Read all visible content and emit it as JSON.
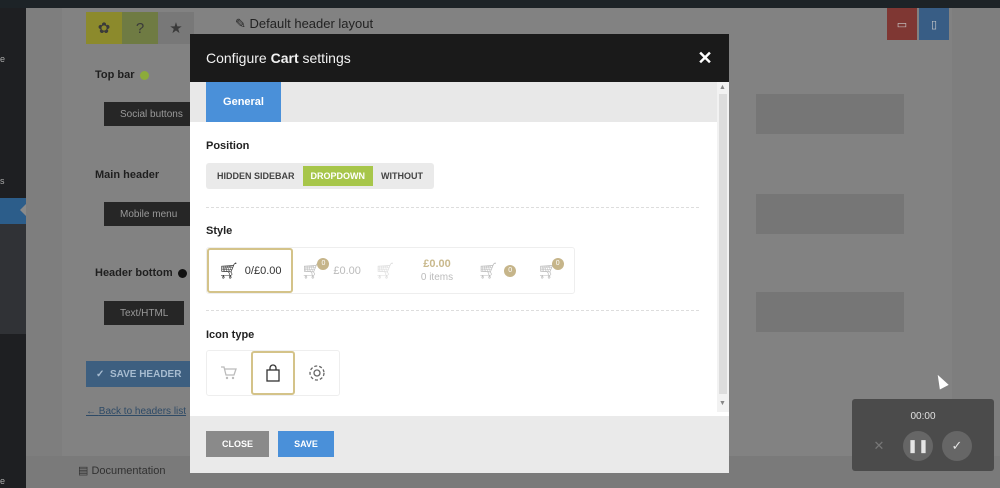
{
  "background": {
    "header_layout_title": "Default header layout",
    "sections": {
      "top_bar": {
        "label": "Top bar",
        "button": "Social buttons"
      },
      "main_header": {
        "label": "Main header",
        "button": "Mobile menu"
      },
      "header_bottom": {
        "label": "Header bottom",
        "button": "Text/HTML"
      }
    },
    "save_header_label": "SAVE HEADER",
    "back_link": "Back to headers list",
    "documentation_link": "Documentation",
    "sidebar_letters": [
      "e",
      "s",
      "e"
    ],
    "colors": {
      "top_bar_dot": "#8cab3a",
      "header_bottom_dot": "#111111"
    }
  },
  "modal": {
    "title_prefix": "Configure ",
    "title_bold": "Cart",
    "title_suffix": " settings",
    "close_symbol": "✕",
    "tabs": [
      {
        "label": "General",
        "active": true
      }
    ],
    "position": {
      "label": "Position",
      "options": [
        {
          "label": "HIDDEN SIDEBAR",
          "active": false
        },
        {
          "label": "DROPDOWN",
          "active": true
        },
        {
          "label": "WITHOUT",
          "active": false
        }
      ]
    },
    "style": {
      "label": "Style",
      "options": [
        {
          "count": "0",
          "sep": " / ",
          "price": "£0.00",
          "active": true
        },
        {
          "badge": "0",
          "price": "£0.00",
          "active": false
        },
        {
          "active": false
        },
        {
          "price": "£0.00",
          "items": "0 items",
          "active": false
        },
        {
          "badge": "0",
          "active": false
        },
        {
          "badge": "0",
          "active": false
        }
      ]
    },
    "icon_type": {
      "label": "Icon type",
      "options": [
        {
          "icon": "cart-icon",
          "active": false
        },
        {
          "icon": "shopping-bag-icon",
          "active": true
        },
        {
          "icon": "gear-icon",
          "active": false
        }
      ]
    },
    "footer": {
      "close_label": "CLOSE",
      "save_label": "SAVE"
    },
    "colors": {
      "accent": "#4a90d9",
      "active_segment": "#a7c64a",
      "selected_border": "#d4c389"
    }
  },
  "recorder": {
    "time": "00:00"
  }
}
